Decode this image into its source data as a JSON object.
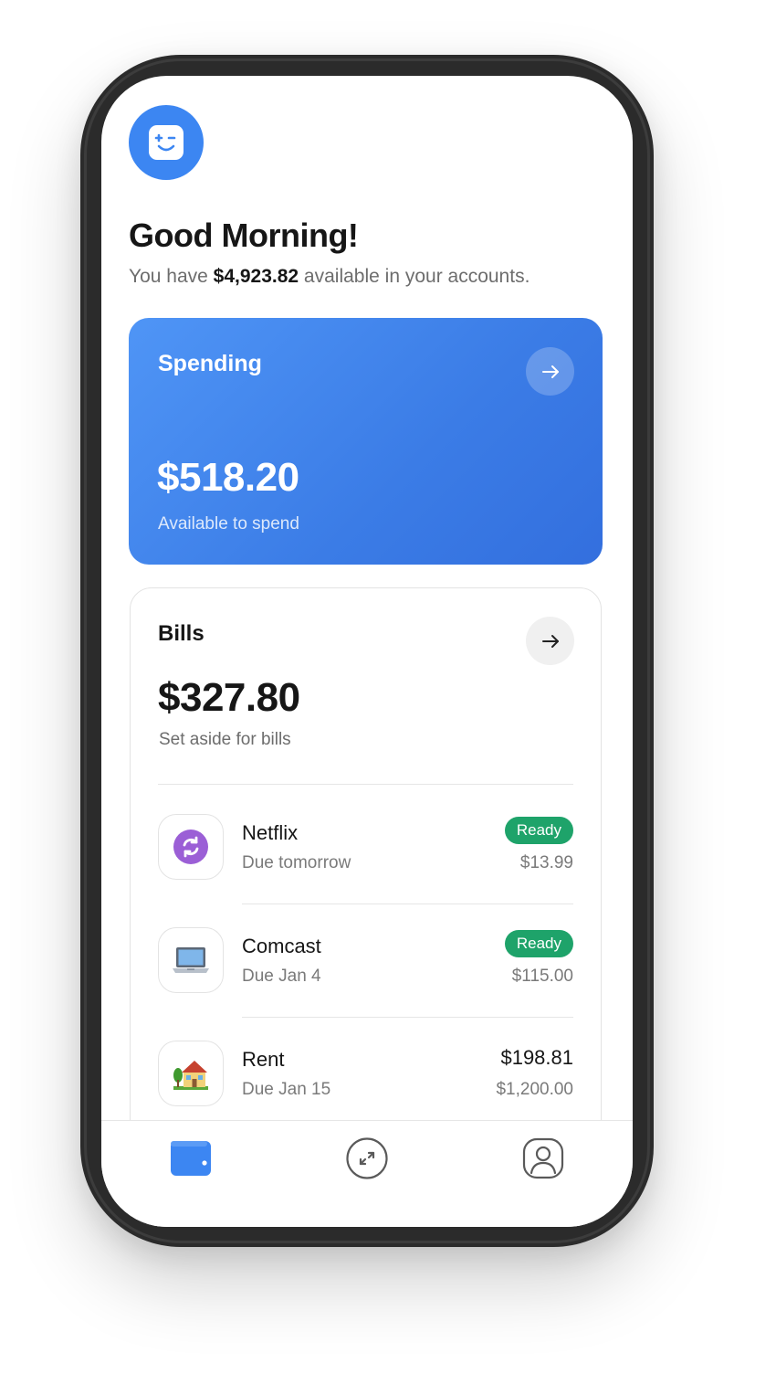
{
  "header": {
    "greeting": "Good Morning!",
    "subtitle_prefix": "You have ",
    "available_total": "$4,923.82",
    "subtitle_suffix": " available in your accounts."
  },
  "spending": {
    "label": "Spending",
    "amount": "$518.20",
    "caption": "Available to spend"
  },
  "bills": {
    "label": "Bills",
    "amount": "$327.80",
    "caption": "Set aside for bills",
    "items": [
      {
        "name": "Netflix",
        "due": "Due tomorrow",
        "status": "Ready",
        "amount": "$13.99",
        "icon": "refresh-icon"
      },
      {
        "name": "Comcast",
        "due": "Due Jan 4",
        "status": "Ready",
        "amount": "$115.00",
        "icon": "laptop-icon"
      },
      {
        "name": "Rent",
        "due": "Due Jan 15",
        "saved": "$198.81",
        "amount": "$1,200.00",
        "icon": "house-icon"
      }
    ]
  },
  "tabs": [
    {
      "name": "wallet",
      "icon": "wallet-icon",
      "active": true
    },
    {
      "name": "transfer",
      "icon": "transfer-icon",
      "active": false
    },
    {
      "name": "profile",
      "icon": "profile-icon",
      "active": false
    }
  ],
  "colors": {
    "accent": "#3c86f2",
    "ready": "#1ea36a",
    "text": "#161616",
    "muted": "#6d6d6d"
  }
}
